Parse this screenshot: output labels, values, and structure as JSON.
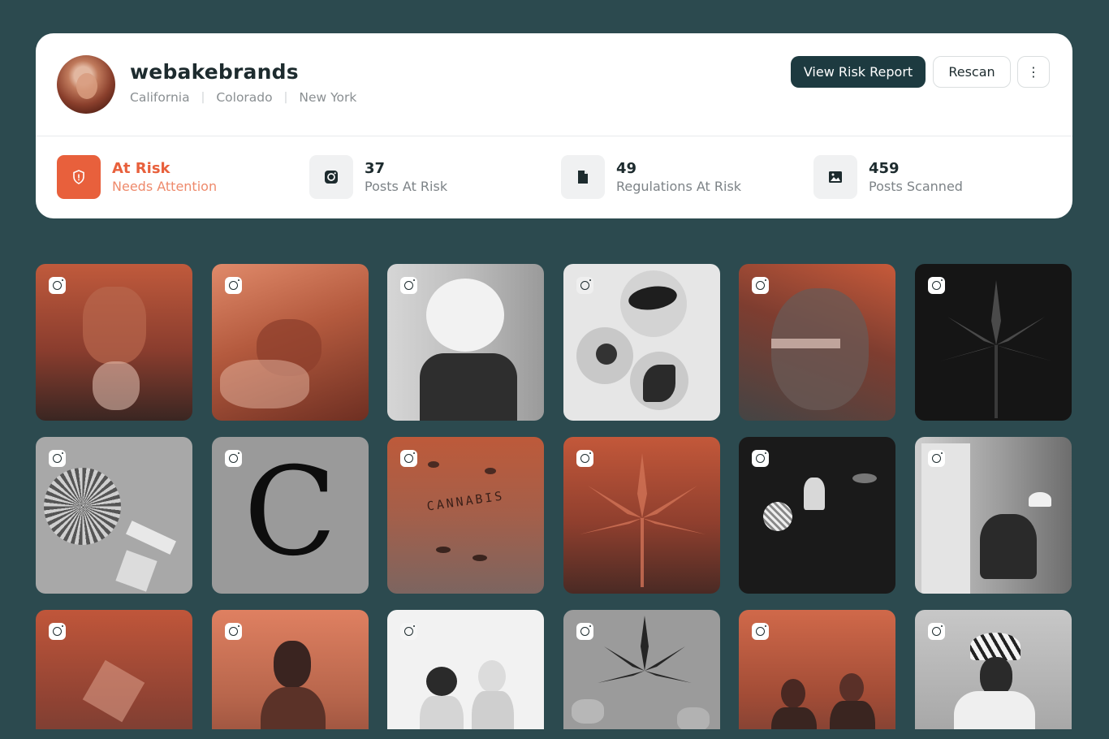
{
  "profile": {
    "username": "webakebrands",
    "locations": [
      "California",
      "Colorado",
      "New York"
    ],
    "avatar_icon": "profile-photo"
  },
  "actions": {
    "view_report_label": "View Risk Report",
    "rescan_label": "Rescan",
    "more_label": "⋮"
  },
  "stats": [
    {
      "value": "At Risk",
      "label": "Needs Attention",
      "icon": "shield-alert-icon",
      "color": "#e8603c"
    },
    {
      "value": "37",
      "label": "Posts At Risk",
      "icon": "instagram-icon"
    },
    {
      "value": "49",
      "label": "Regulations At Risk",
      "icon": "document-icon"
    },
    {
      "value": "459",
      "label": "Posts Scanned",
      "icon": "image-icon"
    }
  ],
  "posts": [
    {
      "subject": "person-smoking",
      "platform": "instagram"
    },
    {
      "subject": "person-lying-in-bed",
      "platform": "instagram"
    },
    {
      "subject": "person-vaping-smoke-cloud",
      "platform": "instagram"
    },
    {
      "subject": "leaf-still-life",
      "platform": "instagram"
    },
    {
      "subject": "face-closeup",
      "platform": "instagram"
    },
    {
      "subject": "cannabis-plant",
      "platform": "instagram"
    },
    {
      "subject": "palm-leaf-and-rolling-papers",
      "platform": "instagram"
    },
    {
      "subject": "letter-c",
      "platform": "instagram",
      "text": "C"
    },
    {
      "subject": "cannabis-letter-tiles",
      "platform": "instagram",
      "text": "CANNABIS"
    },
    {
      "subject": "cannabis-plant",
      "platform": "instagram"
    },
    {
      "subject": "glassware-disco-ball",
      "platform": "instagram"
    },
    {
      "subject": "couple-on-sofa",
      "platform": "instagram"
    },
    {
      "subject": "glass-cube",
      "platform": "instagram"
    },
    {
      "subject": "man-in-smoke",
      "platform": "instagram"
    },
    {
      "subject": "two-women-with-phones",
      "platform": "instagram"
    },
    {
      "subject": "cannabis-leaf-on-gummies",
      "platform": "instagram"
    },
    {
      "subject": "men-smoking",
      "platform": "instagram"
    },
    {
      "subject": "man-in-patterned-hat",
      "platform": "instagram"
    }
  ],
  "colors": {
    "background": "#2c4a4f",
    "primary_button": "#1d3a40",
    "risk_accent": "#e8603c"
  }
}
